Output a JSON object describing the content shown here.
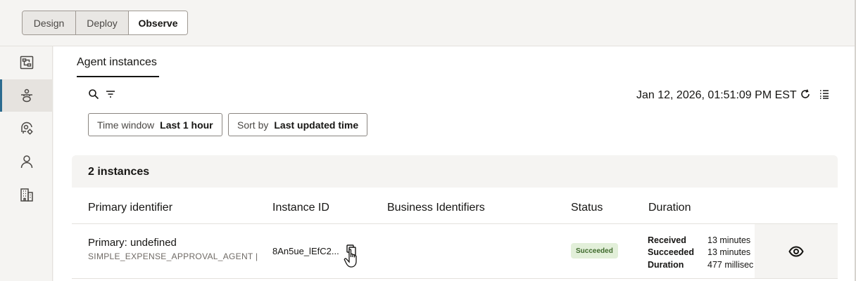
{
  "header": {
    "segments": [
      {
        "label": "Design"
      },
      {
        "label": "Deploy"
      },
      {
        "label": "Observe"
      }
    ]
  },
  "sidebar": {
    "items": [
      {
        "icon": "flow-diagram-icon"
      },
      {
        "icon": "agent-icon"
      },
      {
        "icon": "agent-settings-icon"
      },
      {
        "icon": "person-icon"
      },
      {
        "icon": "building-icon"
      }
    ],
    "active_index": 1
  },
  "main": {
    "tab_label": "Agent instances",
    "timestamp": "Jan 12, 2026, 01:51:09 PM EST",
    "filters": {
      "time_window_label": "Time window",
      "time_window_value": "Last 1 hour",
      "sort_label": "Sort by",
      "sort_value": "Last updated time"
    },
    "table": {
      "count_text": "2 instances",
      "columns": [
        "Primary identifier",
        "Instance ID",
        "Business Identifiers",
        "Status",
        "Duration"
      ],
      "rows": [
        {
          "primary": "Primary: undefined",
          "primary_sub": "SIMPLE_EXPENSE_APPROVAL_AGENT |",
          "instance_id": "8An5ue_lEfC2...",
          "status": "Succeeded",
          "duration": {
            "received_label": "Received",
            "received_value": "13 minutes",
            "succeeded_label": "Succeeded",
            "succeeded_value": "13 minutes",
            "duration_label": "Duration",
            "duration_value": "477 millisec"
          }
        }
      ]
    }
  },
  "colors": {
    "accent": "#2c6b8f",
    "success_bg": "#e2efd9",
    "success_text": "#3f6a2c"
  }
}
